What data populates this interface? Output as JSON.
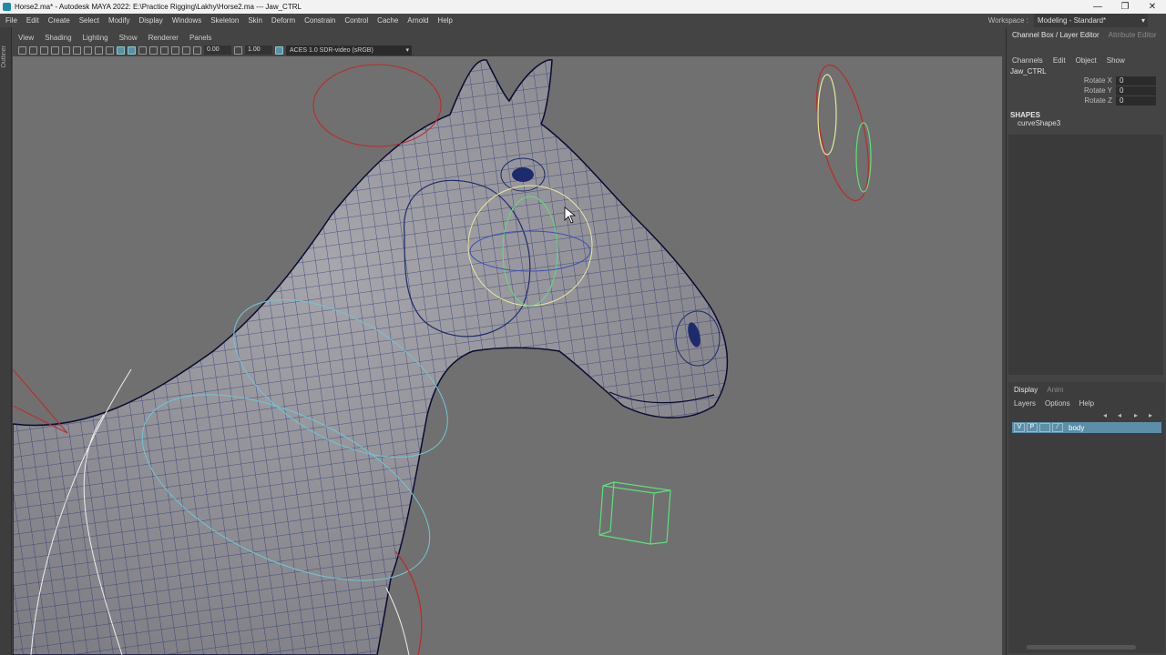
{
  "titlebar": {
    "title": "Horse2.ma* - Autodesk MAYA 2022: E:\\Practice Rigging\\Lakhy\\Horse2.ma   ---   Jaw_CTRL",
    "minimize": "—",
    "maximize": "❐",
    "close": "✕"
  },
  "menubar": {
    "items": [
      "File",
      "Edit",
      "Create",
      "Select",
      "Modify",
      "Display",
      "Windows",
      "Skeleton",
      "Skin",
      "Deform",
      "Constrain",
      "Control",
      "Cache",
      "Arnold",
      "Help"
    ],
    "workspace_label": "Workspace :",
    "workspace_value": "Modeling - Standard*"
  },
  "outliner_strip": {
    "label": "Outliner"
  },
  "panel_menu": {
    "items": [
      "View",
      "Shading",
      "Lighting",
      "Show",
      "Renderer",
      "Panels"
    ]
  },
  "view_toolbar": {
    "exposure": "0.00",
    "gamma": "1.00",
    "color_space": "ACES 1.0 SDR-video (sRGB)"
  },
  "channel_box": {
    "tab_active": "Channel Box / Layer Editor",
    "tab_inactive": "Attribute Editor",
    "menu": [
      "Channels",
      "Edit",
      "Object",
      "Show"
    ],
    "object_name": "Jaw_CTRL",
    "attributes": [
      {
        "label": "Rotate X",
        "value": "0"
      },
      {
        "label": "Rotate Y",
        "value": "0"
      },
      {
        "label": "Rotate Z",
        "value": "0"
      }
    ],
    "shapes_header": "SHAPES",
    "shape_name": "curveShape3"
  },
  "layer_editor": {
    "tab_active": "Display",
    "tab_inactive": "Anim",
    "menu": [
      "Layers",
      "Options",
      "Help"
    ],
    "layer": {
      "v": "V",
      "p": "P",
      "name": "body"
    }
  },
  "colors": {
    "viewport_bg": "#707070",
    "wireframe": "#1e2a6e",
    "mesh": "#8e8e94",
    "selection": "#5b8fa8",
    "ctrl_cyan": "#6fc6d6",
    "ctrl_red": "#c02828",
    "ctrl_green": "#5ee07a",
    "ctrl_yellow": "#e8e89a"
  }
}
